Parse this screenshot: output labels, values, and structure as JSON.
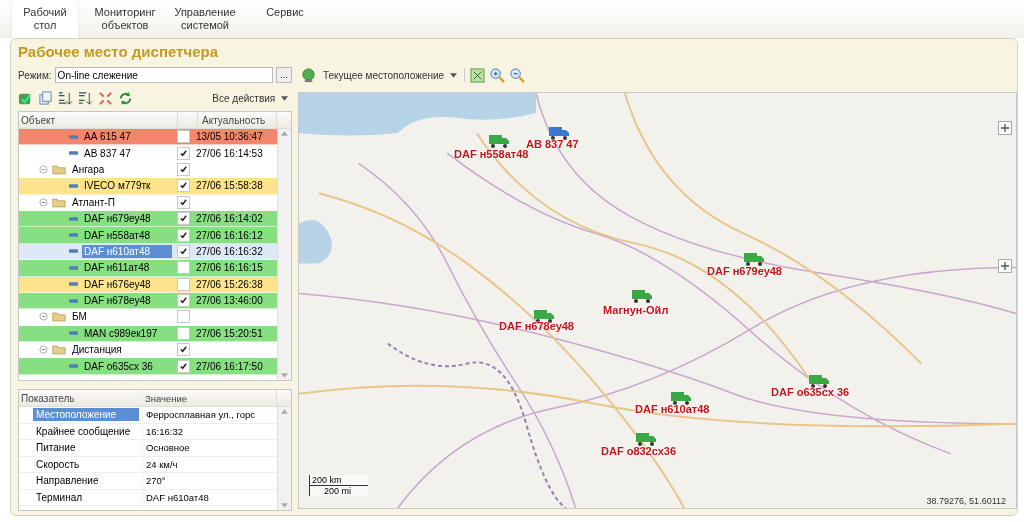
{
  "tabs": [
    {
      "label": "Рабочий стол",
      "selected": true
    },
    {
      "label": "Мониторинг объектов",
      "selected": false
    },
    {
      "label": "Управление системой",
      "selected": false
    },
    {
      "label": "Сервис",
      "selected": false
    }
  ],
  "title": "Рабочее место диспетчера",
  "mode": {
    "label": "Режим:",
    "value": "On-line слежение",
    "button": "..."
  },
  "actions_menu": "Все действия",
  "tree": {
    "columns": [
      "Объект",
      "Актуальность"
    ],
    "items": [
      {
        "kind": "vehicle",
        "name": "АА 615 47",
        "time": "13/05 10:36:47",
        "checked": false,
        "selected": false,
        "color": "#f4866c"
      },
      {
        "kind": "vehicle",
        "name": "АВ 837 47",
        "time": "27/06 16:14:53",
        "checked": true,
        "selected": false,
        "color": "#ffffff"
      },
      {
        "kind": "group",
        "name": "Ангара",
        "checked": true,
        "selected": false,
        "children": [
          {
            "kind": "vehicle",
            "name": "IVECO м779тк",
            "time": "27/06 15:58:38",
            "checked": true,
            "selected": false,
            "color": "#fde48c"
          }
        ]
      },
      {
        "kind": "group",
        "name": "Атлант-П",
        "checked": true,
        "selected": false,
        "children": [
          {
            "kind": "vehicle",
            "name": "DAF н679еу48",
            "time": "27/06 16:14:02",
            "checked": true,
            "selected": false,
            "color": "#86df80"
          },
          {
            "kind": "vehicle",
            "name": "DAF н558ат48",
            "time": "27/06 16:16:12",
            "checked": true,
            "selected": false,
            "color": "#86df80"
          },
          {
            "kind": "vehicle",
            "name": "DAF н610ат48",
            "time": "27/06 16:16:32",
            "checked": true,
            "selected": true
          },
          {
            "kind": "vehicle",
            "name": "DAF н611ат48",
            "time": "27/06 16:16:15",
            "checked": false,
            "selected": false,
            "color": "#86df80"
          },
          {
            "kind": "vehicle",
            "name": "DAF н676еу48",
            "time": "27/06 15:26:38",
            "checked": false,
            "selected": false,
            "color": "#fde48c"
          },
          {
            "kind": "vehicle",
            "name": "DAF н678еу48",
            "time": "27/06 13:46:00",
            "checked": true,
            "selected": false,
            "color": "#86df80"
          }
        ]
      },
      {
        "kind": "group",
        "name": "БМ",
        "checked": false,
        "selected": false,
        "children": [
          {
            "kind": "vehicle",
            "name": "MAN с989ек197",
            "time": "27/06 15:20:51",
            "checked": false,
            "selected": false,
            "color": "#86df80"
          }
        ]
      },
      {
        "kind": "group",
        "name": "Дистанция",
        "checked": true,
        "selected": false,
        "children": [
          {
            "kind": "vehicle",
            "name": "DAF о635сх 36",
            "time": "27/06 16:17:50",
            "checked": true,
            "selected": false,
            "color": "#86df80"
          }
        ]
      }
    ]
  },
  "properties": {
    "columns": [
      "Показатель",
      "Значение"
    ],
    "rows": [
      {
        "name": "Местоположение",
        "value": "Ферросплавная ул., горс",
        "selected": true
      },
      {
        "name": "Крайнее сообщение",
        "value": "16:16:32",
        "selected": false
      },
      {
        "name": "Питание",
        "value": "Основное",
        "selected": false
      },
      {
        "name": "Скорость",
        "value": "24 км/ч",
        "selected": false
      },
      {
        "name": "Направление",
        "value": "270°",
        "selected": false
      },
      {
        "name": "Терминал",
        "value": "DAF н610ат48",
        "selected": false
      }
    ]
  },
  "map": {
    "location_button": "Текущее местоположение",
    "markers": [
      {
        "label": "DAF н558ат48",
        "color": "#3aa845"
      },
      {
        "label": "АВ 837 47",
        "color": "#3a78d8"
      },
      {
        "label": "DAF н679еу48",
        "color": "#3aa845"
      },
      {
        "label": "Магнун-Ойл",
        "color": "#3aa845"
      },
      {
        "label": "DAF н678еу48",
        "color": "#3aa845"
      },
      {
        "label": "DAF о635сх 36",
        "color": "#3aa845"
      },
      {
        "label": "DAF н610ат48",
        "color": "#3aa845"
      },
      {
        "label": "DAF о832сх36",
        "color": "#3aa845"
      }
    ],
    "scale": [
      "200 km",
      "200 mi"
    ],
    "coordinates": "38.79276, 51.60112"
  }
}
